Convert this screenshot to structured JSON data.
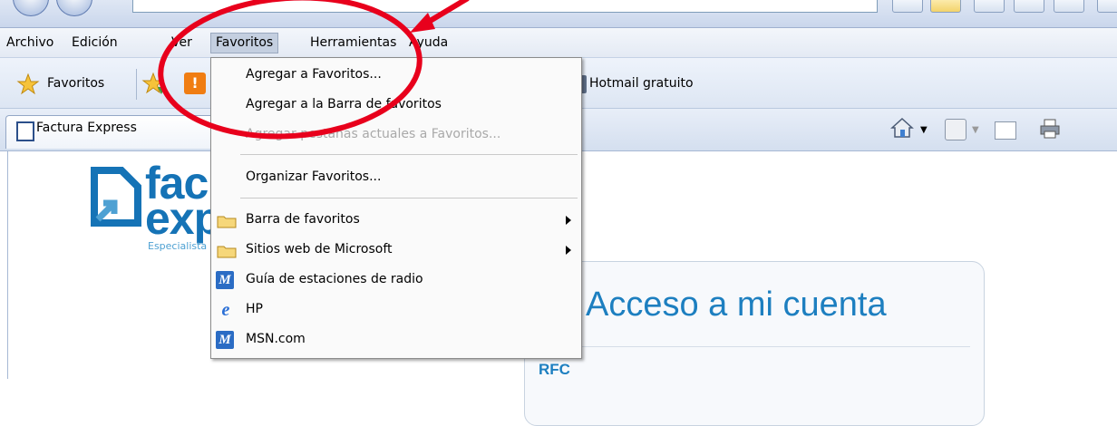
{
  "menubar": {
    "items": [
      "Archivo",
      "Edición",
      "Ver",
      "Favoritos",
      "Herramientas",
      "Ayuda"
    ],
    "active": "Favoritos"
  },
  "favbar": {
    "favorites_label": "Favoritos",
    "hotmail_label": "Hotmail gratuito"
  },
  "tab": {
    "label": "Factura Express"
  },
  "page": {
    "logo_line1": "fac",
    "logo_line2": "exp",
    "logo_tagline": "Especialista",
    "login_title": "Acceso a mi cuenta",
    "rfc_label": "RFC"
  },
  "dropdown": {
    "add_favorites": "Agregar a Favoritos...",
    "add_to_bar": "Agregar a la Barra de favoritos",
    "add_tabs": "Agregar pestañas actuales a Favoritos...",
    "organize": "Organizar Favoritos...",
    "folders": [
      {
        "label": "Barra de favoritos"
      },
      {
        "label": "Sitios web de Microsoft"
      }
    ],
    "links": [
      {
        "label": "Guía de estaciones de radio",
        "icon": "msn-icon"
      },
      {
        "label": "HP",
        "icon": "ie-icon"
      },
      {
        "label": "MSN.com",
        "icon": "msn-icon"
      }
    ]
  },
  "colors": {
    "brand_blue": "#1573b6",
    "annotation_red": "#e8001c"
  }
}
